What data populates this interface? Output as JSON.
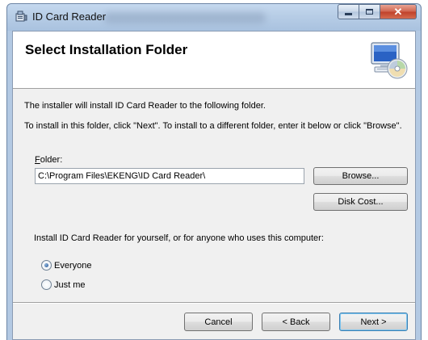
{
  "window": {
    "title": "ID Card Reader"
  },
  "banner": {
    "title": "Select Installation Folder"
  },
  "body": {
    "line1": "The installer will install ID Card Reader to the following folder.",
    "line2": "To install in this folder, click \"Next\". To install to a different folder, enter it below or click \"Browse\".",
    "folder_label_mnemonic": "F",
    "folder_label_rest": "older:",
    "folder_value": "C:\\Program Files\\EKENG\\ID Card Reader\\",
    "install_for": "Install ID Card Reader for yourself, or for anyone who uses this computer:"
  },
  "buttons": {
    "browse": "Browse...",
    "disk_cost": "Disk Cost...",
    "cancel": "Cancel",
    "back": "< Back",
    "next": "Next >"
  },
  "options": {
    "everyone": "Everyone",
    "just_me": "Just me",
    "selected": "Everyone"
  },
  "icons": {
    "app": "installer-icon",
    "banner": "cd-computer-icon"
  },
  "colors": {
    "accent": "#3c7fb1",
    "dialog_bg": "#f0f0f0",
    "close_button": "#c0432c"
  }
}
